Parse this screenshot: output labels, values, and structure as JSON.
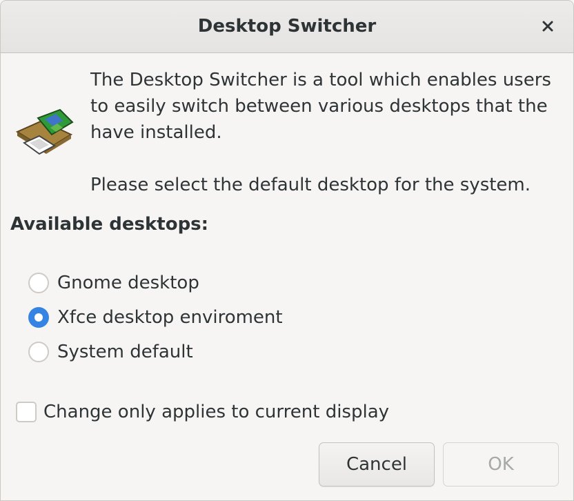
{
  "window": {
    "title": "Desktop Switcher"
  },
  "icons": {
    "close": "close-icon",
    "app": "desktop-switcher-icon"
  },
  "description": {
    "line1": "The Desktop Switcher is a tool which enables users",
    "line2": "to easily switch between various desktops that the",
    "line3": "have installed.",
    "line4": "Please select the default desktop for the system."
  },
  "desktops": {
    "label": "Available desktops:",
    "options": [
      {
        "label": "Gnome desktop",
        "checked": false
      },
      {
        "label": "Xfce desktop enviroment",
        "checked": true
      },
      {
        "label": "System default",
        "checked": false
      }
    ]
  },
  "display_option": {
    "label": "Change only applies to current display",
    "checked": false
  },
  "buttons": {
    "cancel": "Cancel",
    "ok": "OK",
    "ok_enabled": false
  },
  "colors": {
    "accent": "#3584e4",
    "disabled_text": "#a5a9a7"
  }
}
